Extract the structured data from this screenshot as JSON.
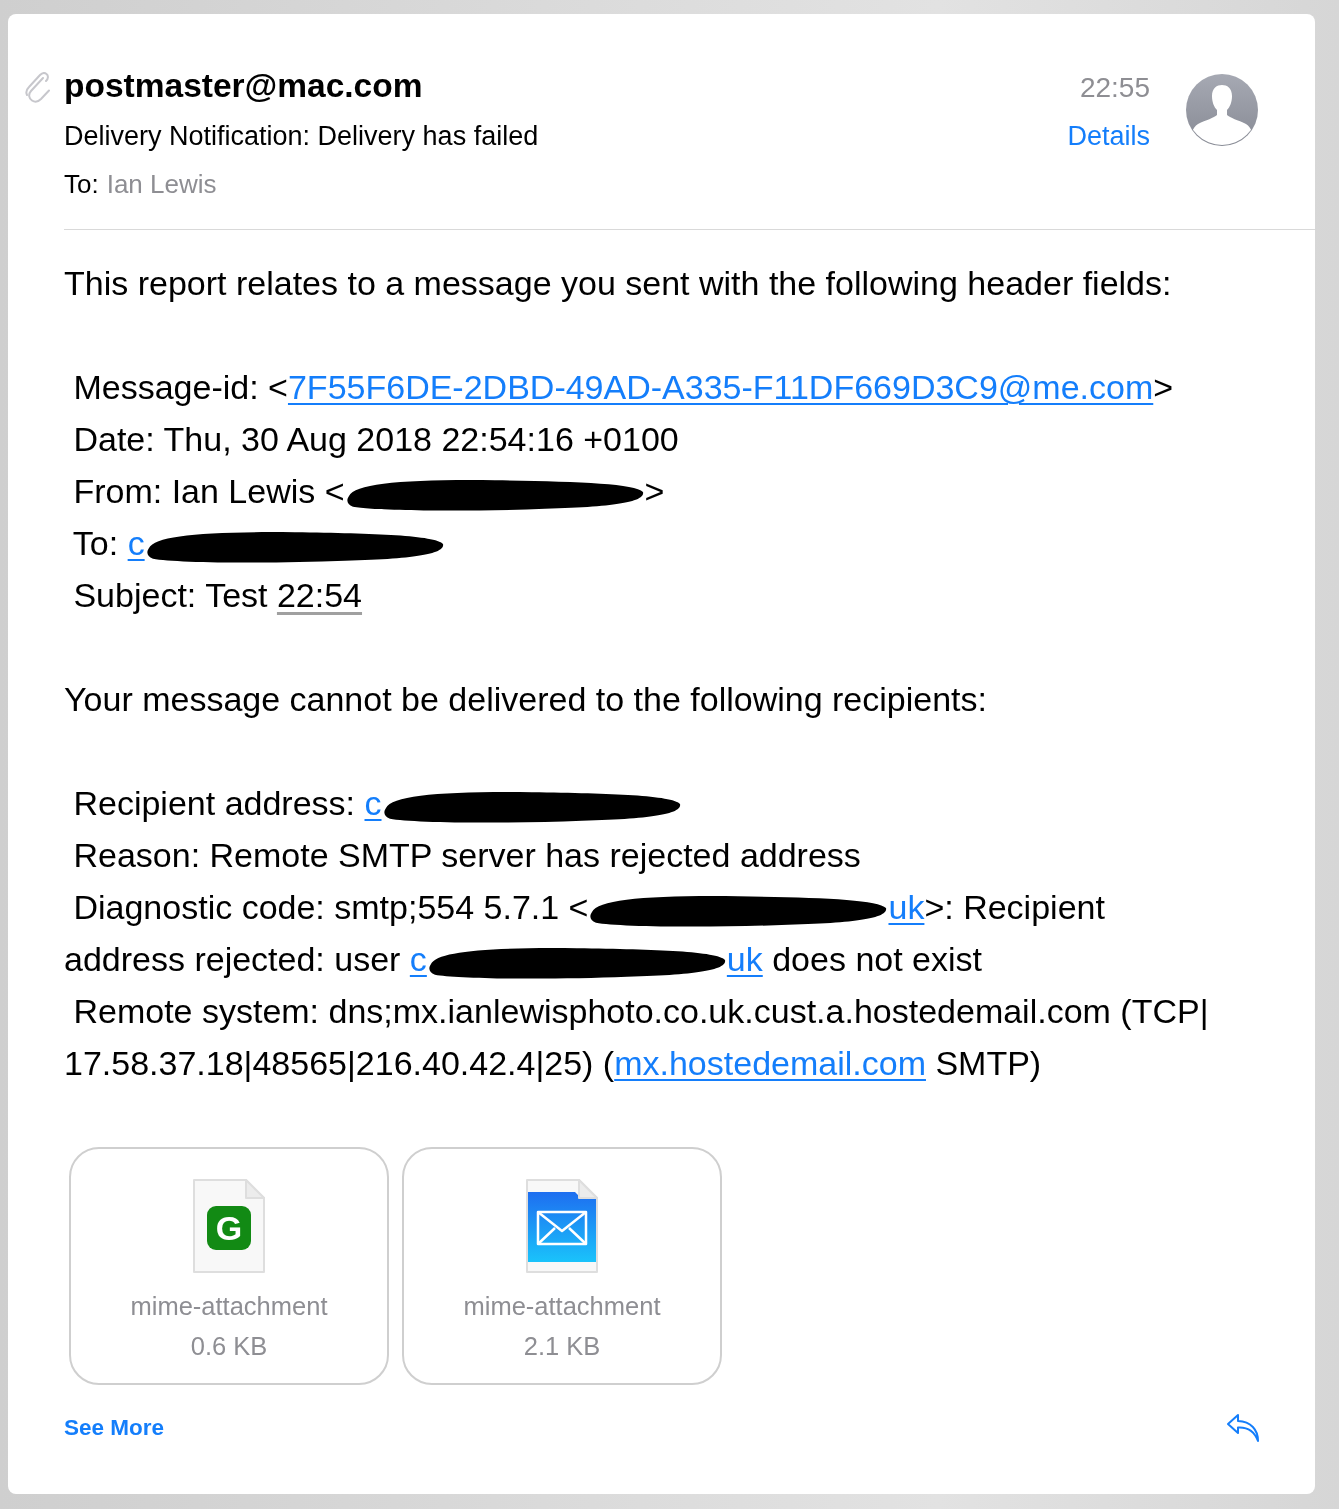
{
  "header": {
    "attachment_indicator": true,
    "sender": "postmaster@mac.com",
    "subject": "Delivery Notification: Delivery has failed",
    "to_label": "To:",
    "to_value": "Ian Lewis",
    "time": "22:55",
    "details_link": "Details"
  },
  "body": [
    {
      "lines": [
        {
          "segments": [
            {
              "kind": "text",
              "text": "This report relates to a message you sent with the following header fields:"
            }
          ]
        }
      ]
    },
    {
      "lines": [
        {
          "segments": [
            {
              "kind": "text",
              "text": " Message-id: <"
            },
            {
              "kind": "link",
              "text": "7F55F6DE-2DBD-49AD-A335-F11DF669D3C9@me.com"
            },
            {
              "kind": "text",
              "text": ">"
            }
          ]
        },
        {
          "segments": [
            {
              "kind": "text",
              "text": " Date: Thu, 30 Aug 2018 22:54:16 +0100"
            }
          ]
        },
        {
          "segments": [
            {
              "kind": "text",
              "text": " From: Ian Lewis <"
            },
            {
              "kind": "redacted"
            },
            {
              "kind": "text",
              "text": ">"
            }
          ]
        },
        {
          "segments": [
            {
              "kind": "text",
              "text": " To: "
            },
            {
              "kind": "link",
              "text": "c"
            },
            {
              "kind": "redacted"
            }
          ]
        },
        {
          "segments": [
            {
              "kind": "text",
              "text": " Subject: Test "
            },
            {
              "kind": "underlined",
              "text": "22:54"
            }
          ]
        }
      ]
    },
    {
      "lines": [
        {
          "segments": [
            {
              "kind": "text",
              "text": "Your message cannot be delivered to the following recipients:"
            }
          ]
        }
      ]
    },
    {
      "lines": [
        {
          "segments": [
            {
              "kind": "text",
              "text": " Recipient address: "
            },
            {
              "kind": "link",
              "text": "c"
            },
            {
              "kind": "redacted"
            }
          ]
        },
        {
          "segments": [
            {
              "kind": "text",
              "text": " Reason: Remote SMTP server has rejected address"
            }
          ]
        },
        {
          "segments": [
            {
              "kind": "text",
              "text": " Diagnostic code: smtp;554 5.7.1 <"
            },
            {
              "kind": "redacted"
            },
            {
              "kind": "link",
              "text": "uk"
            },
            {
              "kind": "text",
              "text": ">: Recipient"
            }
          ]
        },
        {
          "segments": [
            {
              "kind": "text",
              "text": "address rejected: user "
            },
            {
              "kind": "link",
              "text": "c"
            },
            {
              "kind": "redacted"
            },
            {
              "kind": "link",
              "text": "uk"
            },
            {
              "kind": "text",
              "text": " does not exist"
            }
          ]
        },
        {
          "segments": [
            {
              "kind": "text",
              "text": " Remote system: dns;mx.ianlewisphoto.co.uk.cust.a.hostedemail.com (TCP|"
            }
          ]
        },
        {
          "segments": [
            {
              "kind": "text",
              "text": "17.58.37.18|48565|216.40.42.4|25) ("
            },
            {
              "kind": "link",
              "text": "mx.hostedemail.com"
            },
            {
              "kind": "text",
              "text": " SMTP)"
            }
          ]
        }
      ]
    }
  ],
  "attachments": [
    {
      "kind": "app-file",
      "badge": "G",
      "name": "mime-attachment",
      "size": "0.6 KB"
    },
    {
      "kind": "mail-file",
      "name": "mime-attachment",
      "size": "2.1 KB"
    }
  ],
  "footer": {
    "see_more": "See More"
  }
}
